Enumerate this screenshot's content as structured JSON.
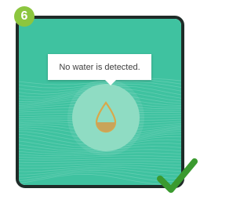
{
  "step": {
    "number": "6",
    "badge_color": "#8cc63f"
  },
  "screen": {
    "background_color": "#3fc2a0",
    "wave_color": "#ffffff",
    "message": "No water is detected.",
    "sensor_icon": "water-drop-icon",
    "sensor_circle_color": "#8fdcc3",
    "drop_outline_color": "#d9a84a",
    "drop_fill_color": "#c9a45a"
  },
  "status": {
    "icon": "checkmark-icon",
    "color": "#3a9a2f"
  }
}
